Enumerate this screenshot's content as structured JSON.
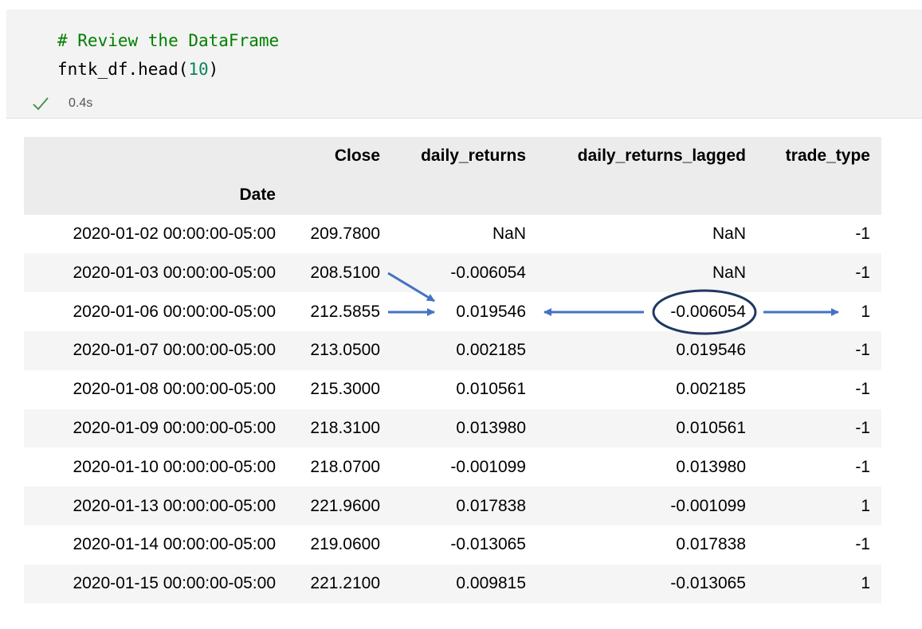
{
  "cell": {
    "code_comment": "# Review the DataFrame",
    "code_call_prefix": "fntk_df.head(",
    "code_call_arg": "10",
    "code_call_suffix": ")",
    "exec_time": "0.4s",
    "status_icon": "check-icon"
  },
  "table": {
    "index_name": "Date",
    "columns": [
      "Close",
      "daily_returns",
      "daily_returns_lagged",
      "trade_type"
    ],
    "rows": [
      [
        "2020-01-02 00:00:00-05:00",
        "209.7800",
        "NaN",
        "NaN",
        "-1"
      ],
      [
        "2020-01-03 00:00:00-05:00",
        "208.5100",
        "-0.006054",
        "NaN",
        "-1"
      ],
      [
        "2020-01-06 00:00:00-05:00",
        "212.5855",
        "0.019546",
        "-0.006054",
        "1"
      ],
      [
        "2020-01-07 00:00:00-05:00",
        "213.0500",
        "0.002185",
        "0.019546",
        "-1"
      ],
      [
        "2020-01-08 00:00:00-05:00",
        "215.3000",
        "0.010561",
        "0.002185",
        "-1"
      ],
      [
        "2020-01-09 00:00:00-05:00",
        "218.3100",
        "0.013980",
        "0.010561",
        "-1"
      ],
      [
        "2020-01-10 00:00:00-05:00",
        "218.0700",
        "-0.001099",
        "0.013980",
        "-1"
      ],
      [
        "2020-01-13 00:00:00-05:00",
        "221.9600",
        "0.017838",
        "-0.001099",
        "1"
      ],
      [
        "2020-01-14 00:00:00-05:00",
        "219.0600",
        "-0.013065",
        "0.017838",
        "-1"
      ],
      [
        "2020-01-15 00:00:00-05:00",
        "221.2100",
        "0.009815",
        "-0.013065",
        "1"
      ]
    ]
  },
  "annotation": {
    "arrow_color": "#4472c4",
    "circle_color": "#203864"
  }
}
